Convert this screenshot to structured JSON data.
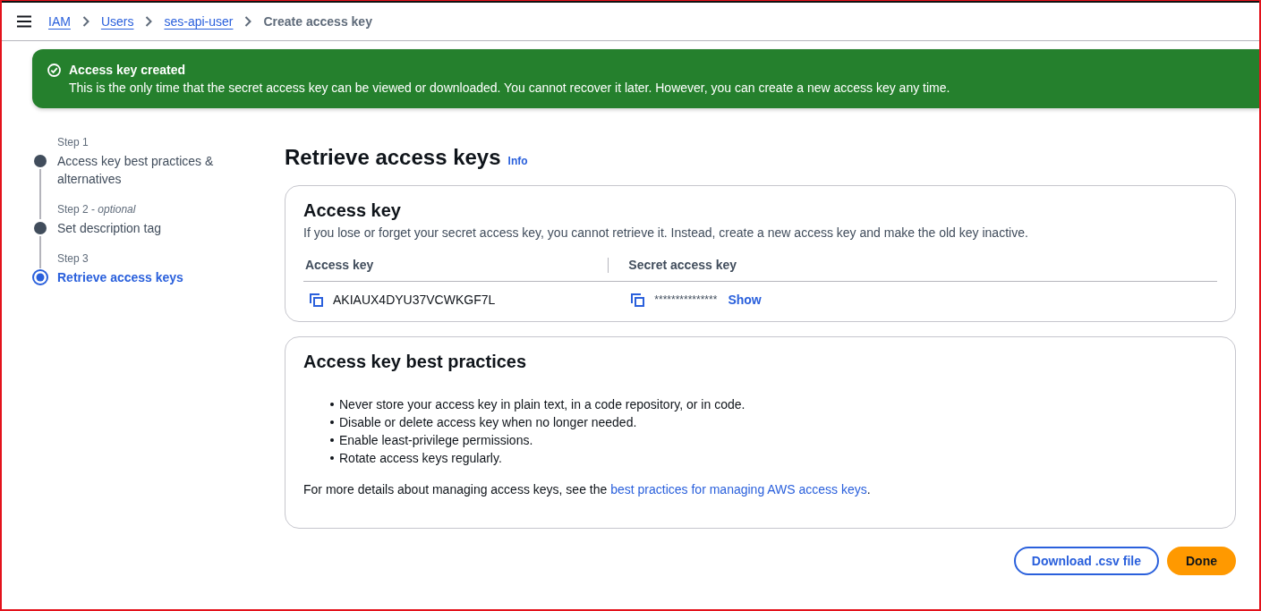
{
  "header": {
    "breadcrumbs": [
      {
        "label": "IAM",
        "kind": "link"
      },
      {
        "label": "Users",
        "kind": "link"
      },
      {
        "label": "ses-api-user",
        "kind": "link"
      },
      {
        "label": "Create access key",
        "kind": "current"
      }
    ]
  },
  "flash": {
    "title": "Access key created",
    "message": "This is the only time that the secret access key can be viewed or downloaded. You cannot recover it later. However, you can create a new access key any time."
  },
  "steps": [
    {
      "step": "Step 1",
      "title": "Access key best practices & alternatives",
      "selected": false
    },
    {
      "step": "Step 2 - *optional*",
      "title": "Set description tag",
      "selected": false
    },
    {
      "step": "Step 3",
      "title": "Retrieve access keys",
      "selected": true
    }
  ],
  "page": {
    "title": "Retrieve access keys",
    "info": "Info"
  },
  "access_key_card": {
    "title": "Access key",
    "description": "If you lose or forget your secret access key, you cannot retrieve it. Instead, create a new access key and make the old key inactive.",
    "columns": [
      "Access key",
      "Secret access key"
    ],
    "row": {
      "access_key": "AKIAUX4DYU37VCWKGF7L",
      "secret_access_key": "***************",
      "show": "Show"
    }
  },
  "best_practices_card": {
    "title": "Access key best practices",
    "items": [
      "Never store your access key in plain text, in a code repository, or in code.",
      "Disable or delete access key when no longer needed.",
      "Enable least-privilege permissions.",
      "Rotate access keys regularly."
    ],
    "details": {
      "text": "For more details about managing access keys, see the ",
      "link": "best practices for managing AWS access keys",
      "end": "."
    }
  },
  "actions": [
    {
      "label": "Download .csv file",
      "kind": "secondary"
    },
    {
      "label": "Done",
      "kind": "primary"
    }
  ]
}
